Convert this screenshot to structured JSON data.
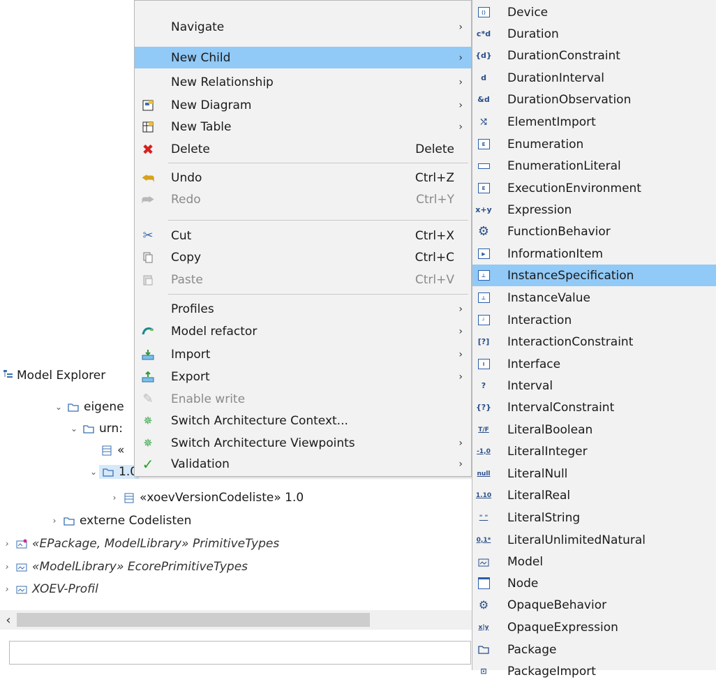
{
  "explorer": {
    "title": "Model Explorer",
    "tree": [
      {
        "label": "eigene",
        "expanded": true,
        "icon": "folder-icon"
      },
      {
        "label": "urn:",
        "expanded": true,
        "icon": "folder-icon"
      },
      {
        "label": "«",
        "icon": "codelist-icon"
      },
      {
        "label": "1.0",
        "expanded": true,
        "icon": "folder-icon"
      },
      {
        "label": "«xoevVersionCodeliste» 1.0",
        "expanded": false,
        "icon": "codelist-icon"
      },
      {
        "label": "externe Codelisten",
        "expanded": false,
        "icon": "folder-icon"
      },
      {
        "label": "«EPackage, ModelLibrary» PrimitiveTypes",
        "expanded": false,
        "icon": "epackage-icon"
      },
      {
        "label": "«ModelLibrary» EcorePrimitiveTypes",
        "expanded": false,
        "icon": "model-library-icon"
      },
      {
        "label": "XOEV-Profil",
        "expanded": false,
        "icon": "profile-icon"
      }
    ],
    "filter_placeholder": ""
  },
  "context_menu": {
    "items": [
      {
        "label": "Navigate",
        "submenu": true
      },
      {
        "label": "New Child",
        "submenu": true,
        "highlighted": true
      },
      {
        "label": "New Relationship",
        "submenu": true
      },
      {
        "label": "New Diagram",
        "submenu": true,
        "icon": "new-diagram-icon"
      },
      {
        "label": "New Table",
        "submenu": true,
        "icon": "new-table-icon"
      },
      {
        "label": "Delete",
        "shortcut": "Delete",
        "icon": "delete-icon"
      },
      {
        "label": "Undo",
        "shortcut": "Ctrl+Z",
        "icon": "undo-icon"
      },
      {
        "label": "Redo",
        "shortcut": "Ctrl+Y",
        "icon": "redo-icon",
        "disabled": true
      },
      {
        "label": "Cut",
        "shortcut": "Ctrl+X",
        "icon": "cut-icon"
      },
      {
        "label": "Copy",
        "shortcut": "Ctrl+C",
        "icon": "copy-icon"
      },
      {
        "label": "Paste",
        "shortcut": "Ctrl+V",
        "icon": "paste-icon",
        "disabled": true
      },
      {
        "label": "Profiles",
        "submenu": true
      },
      {
        "label": "Model refactor",
        "submenu": true,
        "icon": "refactor-icon"
      },
      {
        "label": "Import",
        "submenu": true,
        "icon": "import-icon"
      },
      {
        "label": "Export",
        "submenu": true,
        "icon": "export-icon"
      },
      {
        "label": "Enable write",
        "icon": "pencil-icon",
        "disabled": true
      },
      {
        "label": "Switch Architecture Context...",
        "icon": "architecture-icon"
      },
      {
        "label": "Switch Architecture Viewpoints",
        "submenu": true,
        "icon": "architecture-icon"
      },
      {
        "label": "Validation",
        "submenu": true,
        "icon": "checkmark-icon"
      }
    ]
  },
  "submenu": {
    "items": [
      {
        "label": "Device",
        "icon": "device-icon"
      },
      {
        "label": "Duration",
        "icon": "duration-icon"
      },
      {
        "label": "DurationConstraint",
        "icon": "duration-constraint-icon"
      },
      {
        "label": "DurationInterval",
        "icon": "duration-interval-icon"
      },
      {
        "label": "DurationObservation",
        "icon": "duration-observation-icon"
      },
      {
        "label": "ElementImport",
        "icon": "element-import-icon"
      },
      {
        "label": "Enumeration",
        "icon": "enumeration-icon"
      },
      {
        "label": "EnumerationLiteral",
        "icon": "enumeration-literal-icon"
      },
      {
        "label": "ExecutionEnvironment",
        "icon": "execution-environment-icon"
      },
      {
        "label": "Expression",
        "icon": "expression-icon"
      },
      {
        "label": "FunctionBehavior",
        "icon": "function-behavior-icon"
      },
      {
        "label": "InformationItem",
        "icon": "information-item-icon"
      },
      {
        "label": "InstanceSpecification",
        "icon": "instance-specification-icon",
        "highlighted": true
      },
      {
        "label": "InstanceValue",
        "icon": "instance-value-icon"
      },
      {
        "label": "Interaction",
        "icon": "interaction-icon"
      },
      {
        "label": "InteractionConstraint",
        "icon": "interaction-constraint-icon"
      },
      {
        "label": "Interface",
        "icon": "interface-icon"
      },
      {
        "label": "Interval",
        "icon": "interval-icon"
      },
      {
        "label": "IntervalConstraint",
        "icon": "interval-constraint-icon"
      },
      {
        "label": "LiteralBoolean",
        "icon": "literal-boolean-icon"
      },
      {
        "label": "LiteralInteger",
        "icon": "literal-integer-icon"
      },
      {
        "label": "LiteralNull",
        "icon": "literal-null-icon"
      },
      {
        "label": "LiteralReal",
        "icon": "literal-real-icon"
      },
      {
        "label": "LiteralString",
        "icon": "literal-string-icon"
      },
      {
        "label": "LiteralUnlimitedNatural",
        "icon": "literal-unlimited-natural-icon"
      },
      {
        "label": "Model",
        "icon": "model-icon"
      },
      {
        "label": "Node",
        "icon": "node-icon"
      },
      {
        "label": "OpaqueBehavior",
        "icon": "opaque-behavior-icon"
      },
      {
        "label": "OpaqueExpression",
        "icon": "opaque-expression-icon"
      },
      {
        "label": "Package",
        "icon": "package-icon"
      },
      {
        "label": "PackageImport",
        "icon": "package-import-icon"
      }
    ]
  },
  "colors": {
    "highlight": "#91c9f7",
    "menu_bg": "#f2f2f2",
    "disabled": "#8a8a8a"
  }
}
